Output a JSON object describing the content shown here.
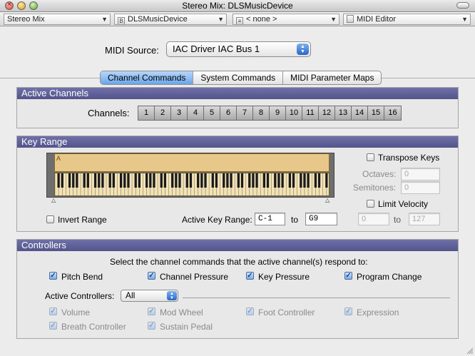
{
  "window": {
    "title": "Stereo Mix: DLSMusicDevice"
  },
  "toolbar": {
    "source_select": "Stereo Mix",
    "device_select": "DLSMusicDevice",
    "preset_select": "< none >",
    "editor_select": "MIDI Editor"
  },
  "midi_source": {
    "label": "MIDI Source:",
    "value": "IAC Driver IAC Bus 1"
  },
  "tabs": [
    {
      "label": "Channel Commands",
      "active": true
    },
    {
      "label": "System Commands",
      "active": false
    },
    {
      "label": "MIDI Parameter Maps",
      "active": false
    }
  ],
  "active_channels": {
    "heading": "Active Channels",
    "label": "Channels:",
    "channels": [
      "1",
      "2",
      "3",
      "4",
      "5",
      "6",
      "7",
      "8",
      "9",
      "10",
      "11",
      "12",
      "13",
      "14",
      "15",
      "16"
    ]
  },
  "key_range": {
    "heading": "Key Range",
    "range_label": "A",
    "invert_label": "Invert Range",
    "active_label": "Active Key Range:",
    "from": "C-1",
    "to_label": "to",
    "to": "G9",
    "transpose_label": "Transpose Keys",
    "octaves_label": "Octaves:",
    "octaves_value": "0",
    "semitones_label": "Semitones:",
    "semitones_value": "0",
    "limit_label": "Limit Velocity",
    "vel_from": "0",
    "vel_to_label": "to",
    "vel_to": "127"
  },
  "controllers": {
    "heading": "Controllers",
    "instruction": "Select the channel commands that the active channel(s) respond to:",
    "commands": [
      "Pitch Bend",
      "Channel Pressure",
      "Key Pressure",
      "Program Change"
    ],
    "active_label": "Active Controllers:",
    "active_value": "All",
    "items": [
      "Volume",
      "Mod Wheel",
      "Foot Controller",
      "Expression",
      "Breath Controller",
      "Sustain Pedal"
    ]
  },
  "colors": {
    "group_header": "#5b5b92",
    "range_fill": "#e8c88a",
    "accent": "#3b7ad8"
  }
}
